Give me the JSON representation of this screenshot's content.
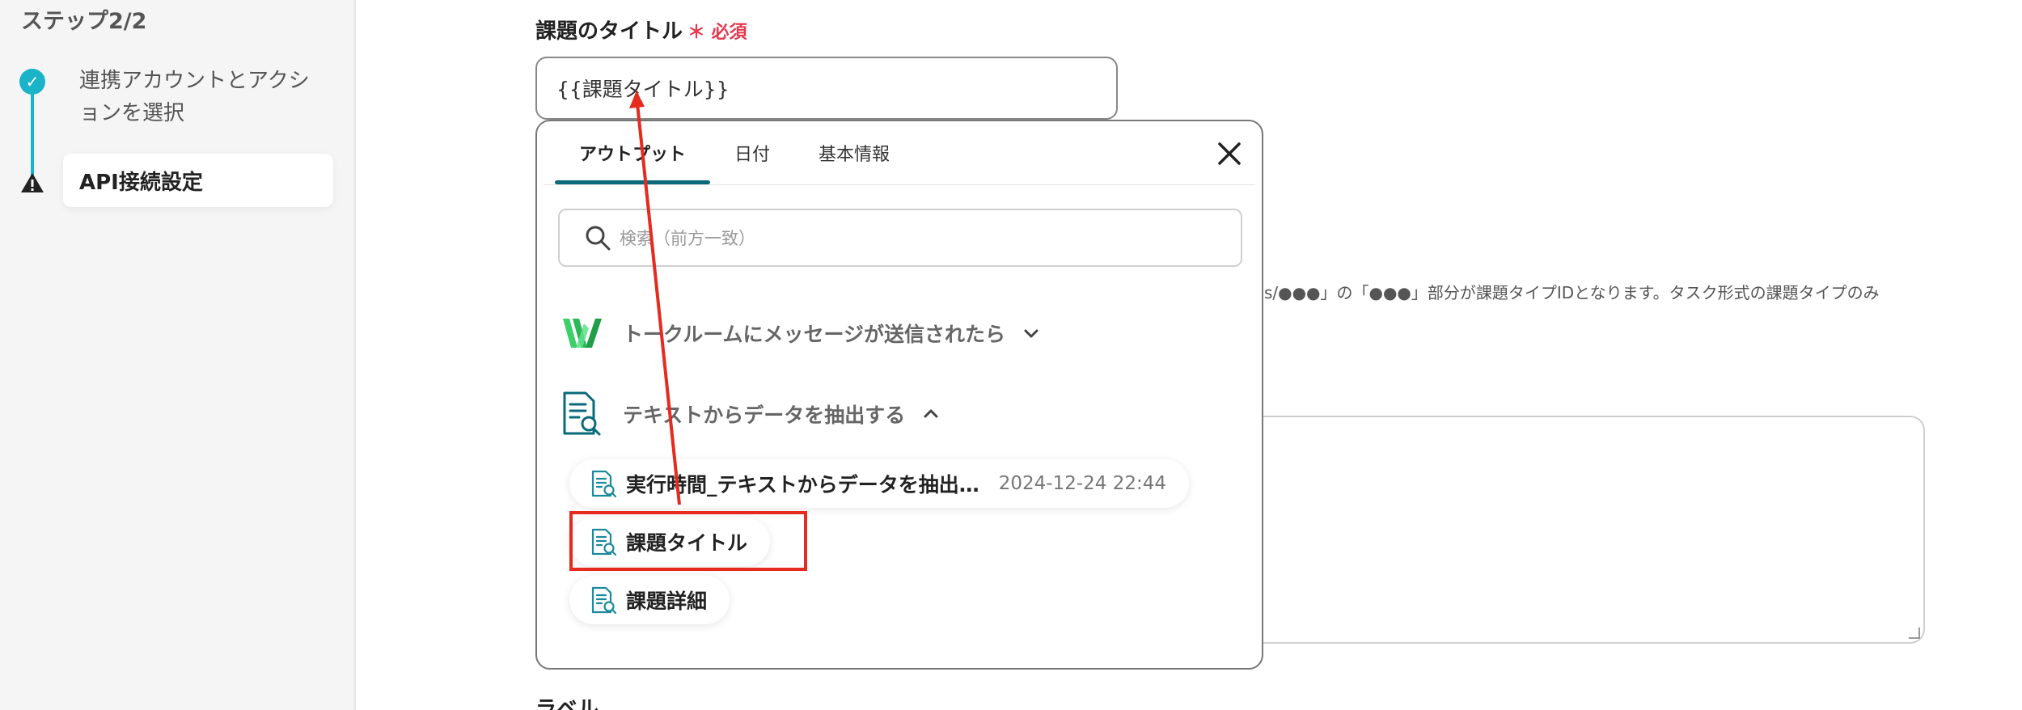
{
  "sidebar": {
    "step_title": "ステップ2/2",
    "steps": [
      {
        "label": "連携アカウントとアクションを選択",
        "status": "done"
      },
      {
        "label": "API接続設定",
        "status": "warning"
      }
    ]
  },
  "form": {
    "title_label": "課題のタイトル",
    "required_mark": "＊ 必須",
    "title_value": "{{課題タイトル}}",
    "hint_text": "pes/●●●」の「●●●」部分が課題タイプIDとなります。タスク形式の課題タイプのみ",
    "bottom_label": "ラベル"
  },
  "panel": {
    "tabs": [
      {
        "label": "アウトプット",
        "active": true
      },
      {
        "label": "日付",
        "active": false
      },
      {
        "label": "基本情報",
        "active": false
      }
    ],
    "search_placeholder": "検索（前方一致）",
    "groups": [
      {
        "label": "トークルームにメッセージが送信されたら",
        "icon": "worksmobile-logo-icon",
        "expanded": false
      },
      {
        "label": "テキストからデータを抽出する",
        "icon": "document-search-icon",
        "expanded": true
      }
    ],
    "items": [
      {
        "label": "実行時間_テキストからデータを抽出…",
        "time": "2024-12-24 22:44"
      },
      {
        "label": "課題タイトル",
        "highlighted": true
      },
      {
        "label": "課題詳細"
      }
    ]
  },
  "colors": {
    "accent": "#1ab3c7",
    "tab_underline": "#0b6a7a",
    "required": "#e53950",
    "annotation_red": "#e52a1e"
  }
}
